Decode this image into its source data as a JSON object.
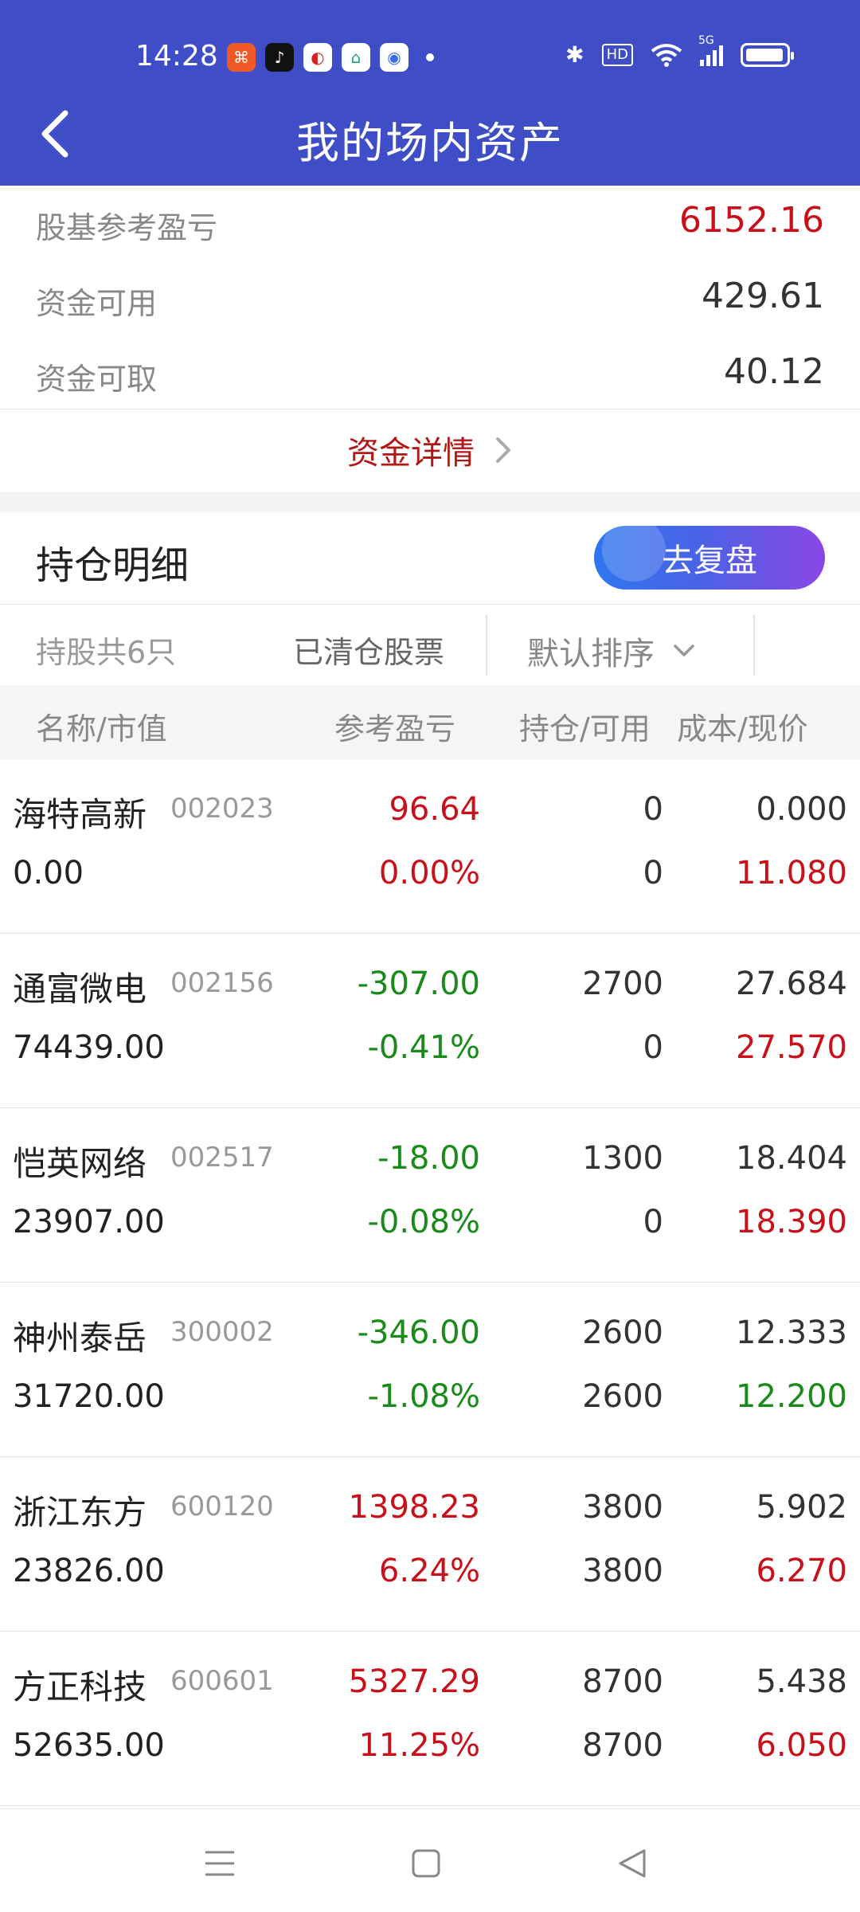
{
  "status": {
    "time": "14:28",
    "hd": "HD",
    "network": "5G"
  },
  "header": {
    "title": "我的场内资产"
  },
  "summary": {
    "rows": [
      {
        "label": "股基参考盈亏",
        "value": "6152.16"
      },
      {
        "label": "资金可用",
        "value": "429.61"
      },
      {
        "label": "资金可取",
        "value": "40.12"
      }
    ],
    "fund_detail_link": "资金详情"
  },
  "holdings": {
    "title": "持仓明细",
    "review_button": "去复盘",
    "count_label": "持股共6只",
    "cleared_label": "已清仓股票",
    "sort_label": "默认排序",
    "columns": [
      "名称/市值",
      "参考盈亏",
      "持仓/可用",
      "成本/现价"
    ],
    "rows": [
      {
        "name": "海特高新",
        "code": "002023",
        "market_value": "0.00",
        "pl": "96.64",
        "pl_pct": "0.00%",
        "position": "0",
        "available": "0",
        "cost": "0.000",
        "price": "11.080"
      },
      {
        "name": "通富微电",
        "code": "002156",
        "market_value": "74439.00",
        "pl": "-307.00",
        "pl_pct": "-0.41%",
        "position": "2700",
        "available": "0",
        "cost": "27.684",
        "price": "27.570"
      },
      {
        "name": "恺英网络",
        "code": "002517",
        "market_value": "23907.00",
        "pl": "-18.00",
        "pl_pct": "-0.08%",
        "position": "1300",
        "available": "0",
        "cost": "18.404",
        "price": "18.390"
      },
      {
        "name": "神州泰岳",
        "code": "300002",
        "market_value": "31720.00",
        "pl": "-346.00",
        "pl_pct": "-1.08%",
        "position": "2600",
        "available": "2600",
        "cost": "12.333",
        "price": "12.200"
      },
      {
        "name": "浙江东方",
        "code": "600120",
        "market_value": "23826.00",
        "pl": "1398.23",
        "pl_pct": "6.24%",
        "position": "3800",
        "available": "3800",
        "cost": "5.902",
        "price": "6.270"
      },
      {
        "name": "方正科技",
        "code": "600601",
        "market_value": "52635.00",
        "pl": "5327.29",
        "pl_pct": "11.25%",
        "position": "8700",
        "available": "8700",
        "cost": "5.438",
        "price": "6.050"
      }
    ]
  },
  "colors": {
    "header_bg": "#3f4ec6",
    "up_red": "#c8101a",
    "down_green": "#1a8a1a"
  },
  "icons": [
    "back-arrow-icon",
    "chevron-right-icon",
    "chevron-down-icon",
    "menu-nav-icon",
    "home-nav-icon",
    "back-nav-icon"
  ]
}
